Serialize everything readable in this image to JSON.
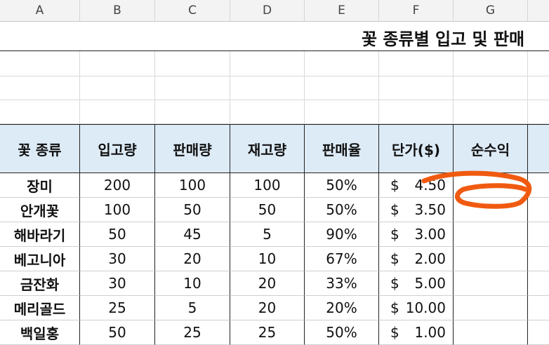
{
  "columns": [
    "A",
    "B",
    "C",
    "D",
    "E",
    "F",
    "G"
  ],
  "title": "꽃 종류별 입고 및 판매",
  "headers": [
    "꽃 종류",
    "입고량",
    "판매량",
    "재고량",
    "판매율",
    "단가($)",
    "순수익"
  ],
  "rows": [
    {
      "name": "장미",
      "in": "200",
      "sold": "100",
      "stock": "100",
      "rate": "50%",
      "cur": "$",
      "price": "4.50",
      "profit": "="
    },
    {
      "name": "안개꽃",
      "in": "100",
      "sold": "50",
      "stock": "50",
      "rate": "50%",
      "cur": "$",
      "price": "3.50",
      "profit": ""
    },
    {
      "name": "해바라기",
      "in": "50",
      "sold": "45",
      "stock": "5",
      "rate": "90%",
      "cur": "$",
      "price": "3.00",
      "profit": ""
    },
    {
      "name": "베고니아",
      "in": "30",
      "sold": "20",
      "stock": "10",
      "rate": "67%",
      "cur": "$",
      "price": "2.00",
      "profit": ""
    },
    {
      "name": "금잔화",
      "in": "30",
      "sold": "10",
      "stock": "20",
      "rate": "33%",
      "cur": "$",
      "price": "5.00",
      "profit": ""
    },
    {
      "name": "메리골드",
      "in": "25",
      "sold": "5",
      "stock": "20",
      "rate": "20%",
      "cur": "$",
      "price": "10.00",
      "profit": ""
    },
    {
      "name": "백일홍",
      "in": "50",
      "sold": "25",
      "stock": "25",
      "rate": "50%",
      "cur": "$",
      "price": "1.00",
      "profit": ""
    }
  ],
  "annotation_color": "#f05a10"
}
